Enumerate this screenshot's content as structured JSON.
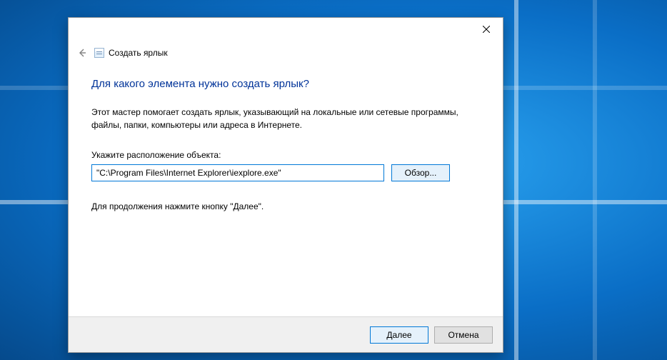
{
  "wizard": {
    "small_title": "Создать ярлык",
    "heading": "Для какого элемента нужно создать ярлык?",
    "explain": "Этот мастер помогает создать ярлык, указывающий на локальные или сетевые программы, файлы, папки, компьютеры или адреса в Интернете.",
    "field_label": "Укажите расположение объекта:",
    "location_value": "\"C:\\Program Files\\Internet Explorer\\iexplore.exe\"",
    "browse_label": "Обзор...",
    "continue_hint": "Для продолжения нажмите кнопку \"Далее\"."
  },
  "footer": {
    "next_label": "Далее",
    "cancel_label": "Отмена"
  }
}
